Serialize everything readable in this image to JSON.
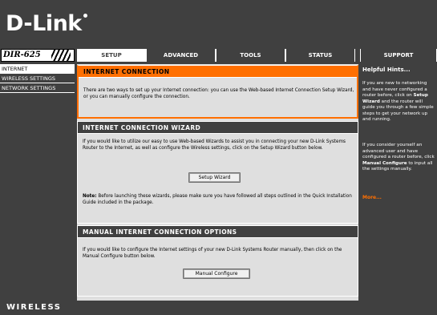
{
  "brand": {
    "logo_text": "D-Link",
    "model": "DIR-625",
    "footer_label": "WIRELESS"
  },
  "colors": {
    "orange": "#ff6f00",
    "dark": "#404040",
    "panel": "#dfdfdf"
  },
  "tabs": [
    {
      "label": "SETUP",
      "active": true
    },
    {
      "label": "ADVANCED",
      "active": false
    },
    {
      "label": "TOOLS",
      "active": false
    },
    {
      "label": "STATUS",
      "active": false
    },
    {
      "label": "SUPPORT",
      "active": false
    }
  ],
  "sidebar": {
    "items": [
      {
        "label": "INTERNET",
        "active": true
      },
      {
        "label": "WIRELESS SETTINGS",
        "active": false
      },
      {
        "label": "NETWORK SETTINGS",
        "active": false
      }
    ]
  },
  "internet_connection": {
    "title": "INTERNET CONNECTION",
    "text": "There are two ways to set up your Internet connection: you can use the Web-based Internet Connection Setup Wizard, or you can manually configure the connection."
  },
  "wizard": {
    "title": "INTERNET CONNECTION WIZARD",
    "text": "If you would like to utilize our easy to use Web-based Wizards to assist you in connecting your new D-Link Systems Router to the Internet, as well as configure the Wireless settings, click on the Setup Wizard button below.",
    "button_label": "Setup Wizard",
    "note_label": "Note:",
    "note_text": " Before launching these wizards, please make sure you have followed all steps outlined in the Quick Installation Guide included in the package."
  },
  "manual": {
    "title": "MANUAL INTERNET CONNECTION OPTIONS",
    "text": "If you would like to configure the Internet settings of your new D-Link Systems Router manually, then click on the Manual Configure button below.",
    "button_label": "Manual Configure"
  },
  "support": {
    "title": "Helpful Hints...",
    "hint1_pre": "If you are new to networking and have never configured a router before, click on ",
    "hint1_bold": "Setup Wizard",
    "hint1_post": " and the router will guide you through a few simple steps to get your network up and running.",
    "hint2_pre": "If you consider yourself an advanced user and have configured a router before, click ",
    "hint2_bold": "Manual Configure",
    "hint2_post": " to input all the settings manually.",
    "more_label": "More..."
  }
}
